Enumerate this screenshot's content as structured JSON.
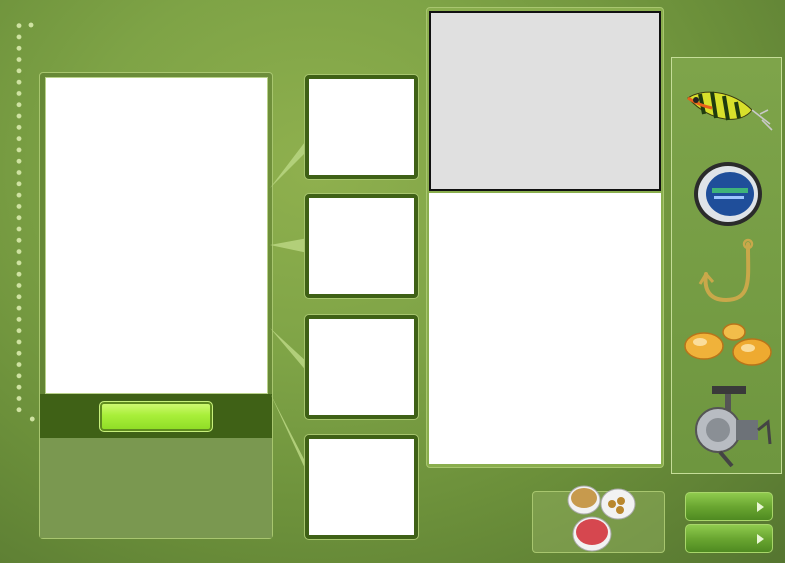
{
  "ui": {
    "main_button_label": "",
    "next_button_1_label": "",
    "next_button_2_label": ""
  },
  "icons": {
    "products": [
      "fishing-lure-icon",
      "fishing-line-spool-icon",
      "fishing-hook-icon",
      "corn-bait-icon",
      "spinning-reel-icon"
    ],
    "bait_cups": "bait-cups-icon",
    "arrow": "chevron-right-icon",
    "play": "play-triangle-icon"
  },
  "colors": {
    "background": "#7ea346",
    "dark_green": "#3f6116",
    "lime_button": "#a9ef3a",
    "button_green": "#6aa631",
    "panel_border": "#a8c66f"
  }
}
